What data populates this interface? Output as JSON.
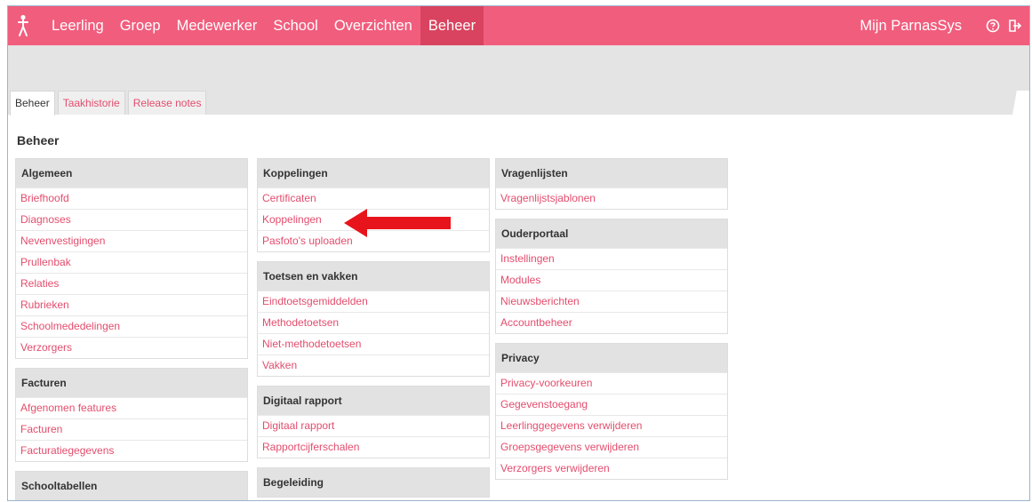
{
  "topbar": {
    "nav": [
      "Leerling",
      "Groep",
      "Medewerker",
      "School",
      "Overzichten",
      "Beheer"
    ],
    "active_nav": "Beheer",
    "user_link": "Mijn ParnasSys",
    "icons": [
      "person-logo-icon",
      "help-icon",
      "logout-icon"
    ]
  },
  "tabs": [
    "Beheer",
    "Taakhistorie",
    "Release notes"
  ],
  "active_tab": "Beheer",
  "page_title": "Beheer",
  "columns": [
    [
      {
        "title": "Algemeen",
        "items": [
          "Briefhoofd",
          "Diagnoses",
          "Nevenvestigingen",
          "Prullenbak",
          "Relaties",
          "Rubrieken",
          "Schoolmededelingen",
          "Verzorgers"
        ]
      },
      {
        "title": "Facturen",
        "items": [
          "Afgenomen features",
          "Facturen",
          "Facturatiegegevens"
        ]
      },
      {
        "title": "Schooltabellen",
        "items": []
      }
    ],
    [
      {
        "title": "Koppelingen",
        "items": [
          "Certificaten",
          "Koppelingen",
          "Pasfoto's uploaden"
        ]
      },
      {
        "title": "Toetsen en vakken",
        "items": [
          "Eindtoetsgemiddelden",
          "Methodetoetsen",
          "Niet-methodetoetsen",
          "Vakken"
        ]
      },
      {
        "title": "Digitaal rapport",
        "items": [
          "Digitaal rapport",
          "Rapportcijferschalen"
        ]
      },
      {
        "title": "Begeleiding",
        "items": []
      }
    ],
    [
      {
        "title": "Vragenlijsten",
        "items": [
          "Vragenlijstsjablonen"
        ]
      },
      {
        "title": "Ouderportaal",
        "items": [
          "Instellingen",
          "Modules",
          "Nieuwsberichten",
          "Accountbeheer"
        ]
      },
      {
        "title": "Privacy",
        "items": [
          "Privacy-voorkeuren",
          "Gegevenstoegang",
          "Leerlinggegevens verwijderen",
          "Groepsgegevens verwijderen",
          "Verzorgers verwijderen"
        ]
      }
    ]
  ],
  "colors": {
    "topbar": "#f15d7d",
    "topbar_active": "#d9435f",
    "link": "#e34d6d",
    "panel_header": "#e2e2e2",
    "arrow": "#e8141c"
  }
}
